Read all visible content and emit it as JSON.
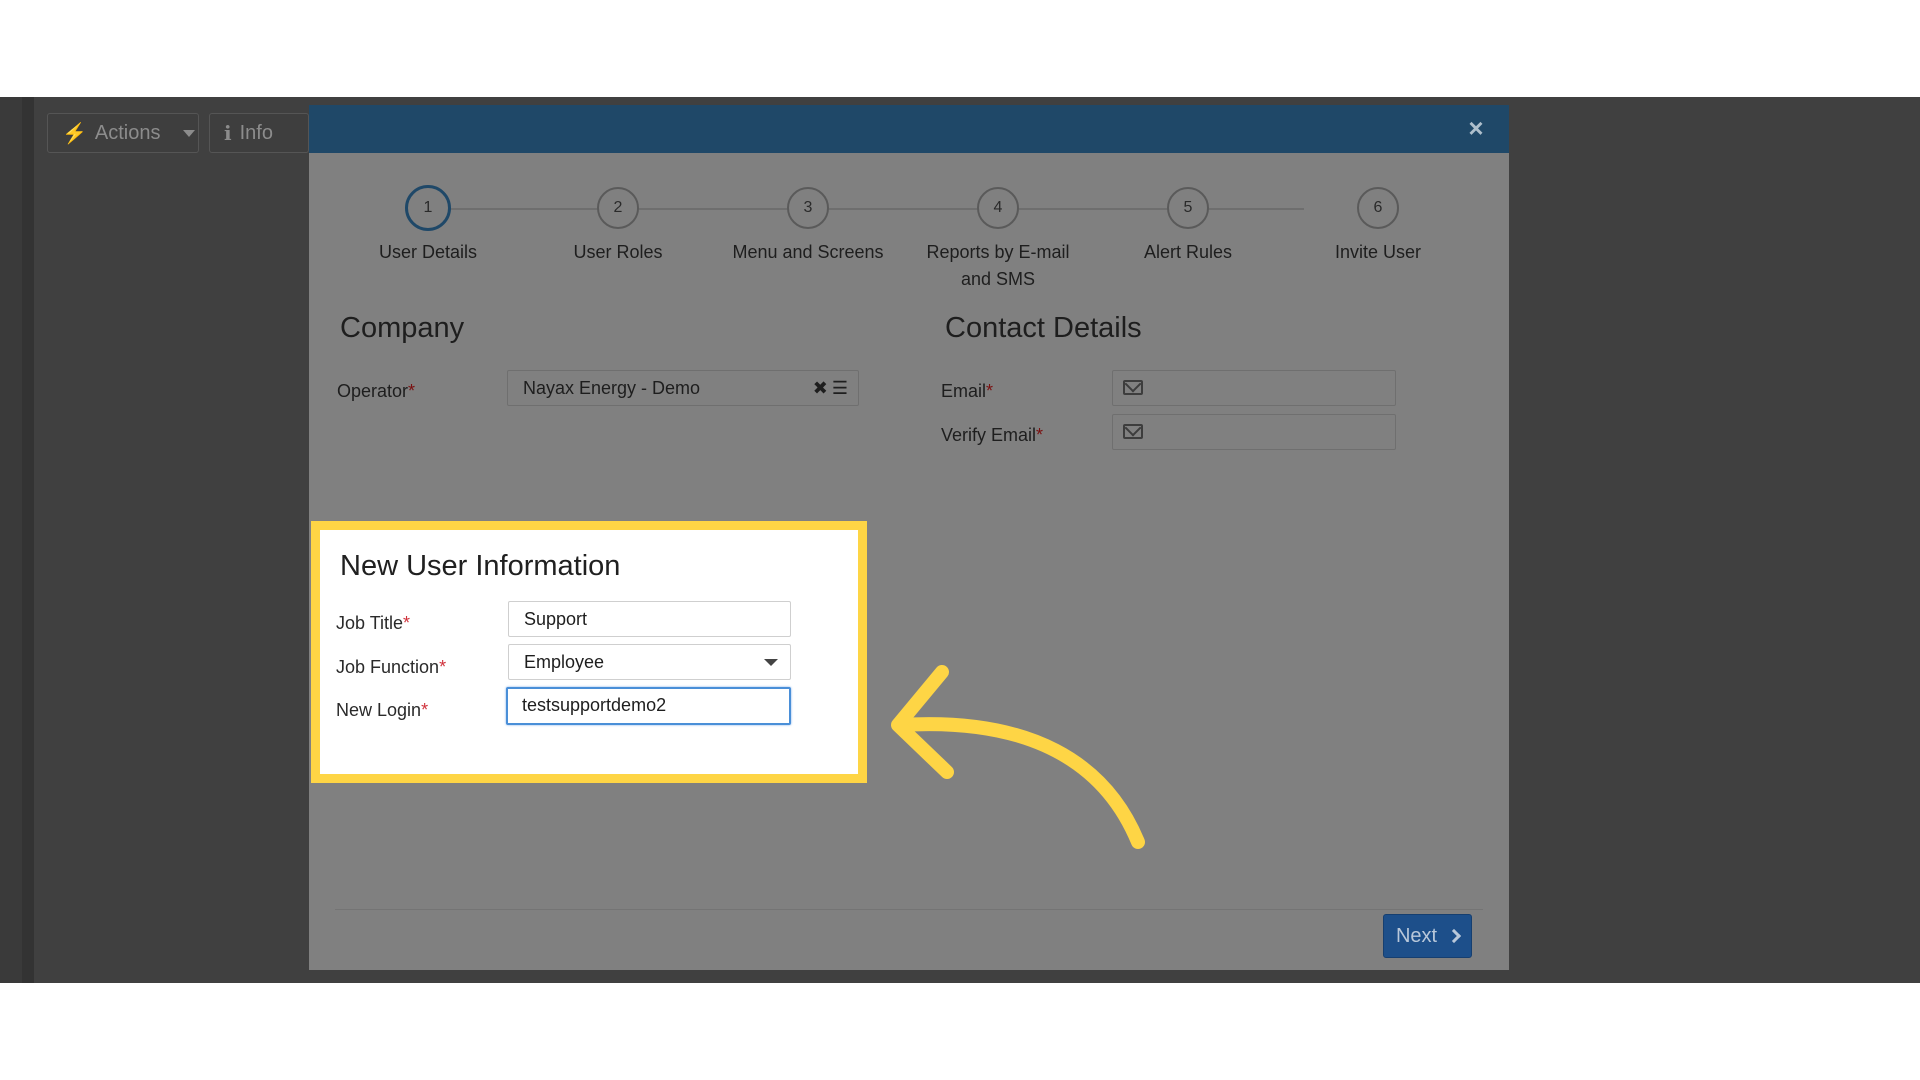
{
  "background": {
    "actions_label": "Actions",
    "info_label": "Info"
  },
  "modal": {
    "close_glyph": "×",
    "steps": [
      {
        "number": "1",
        "label": "User Details"
      },
      {
        "number": "2",
        "label": "User Roles"
      },
      {
        "number": "3",
        "label": "Menu and Screens"
      },
      {
        "number": "4",
        "label": "Reports by E-mail and SMS"
      },
      {
        "number": "5",
        "label": "Alert Rules"
      },
      {
        "number": "6",
        "label": "Invite User"
      }
    ],
    "active_step": 1,
    "company": {
      "title": "Company",
      "operator_label": "Operator",
      "operator_value": "Nayax Energy - Demo"
    },
    "contact": {
      "title": "Contact Details",
      "email_label": "Email",
      "verify_email_label": "Verify Email",
      "email_value": "",
      "verify_email_value": ""
    },
    "new_user": {
      "title": "New User Information",
      "job_title_label": "Job Title",
      "job_title_value": "Support",
      "job_function_label": "Job Function",
      "job_function_value": "Employee",
      "new_login_label": "New Login",
      "new_login_value": "testsupportdemo2"
    },
    "required_mark": "*",
    "next_label": "Next"
  },
  "colors": {
    "highlight": "#fed545",
    "header": "#1f4868",
    "next_button": "#1d4f8a",
    "arrow": "#fed545"
  }
}
